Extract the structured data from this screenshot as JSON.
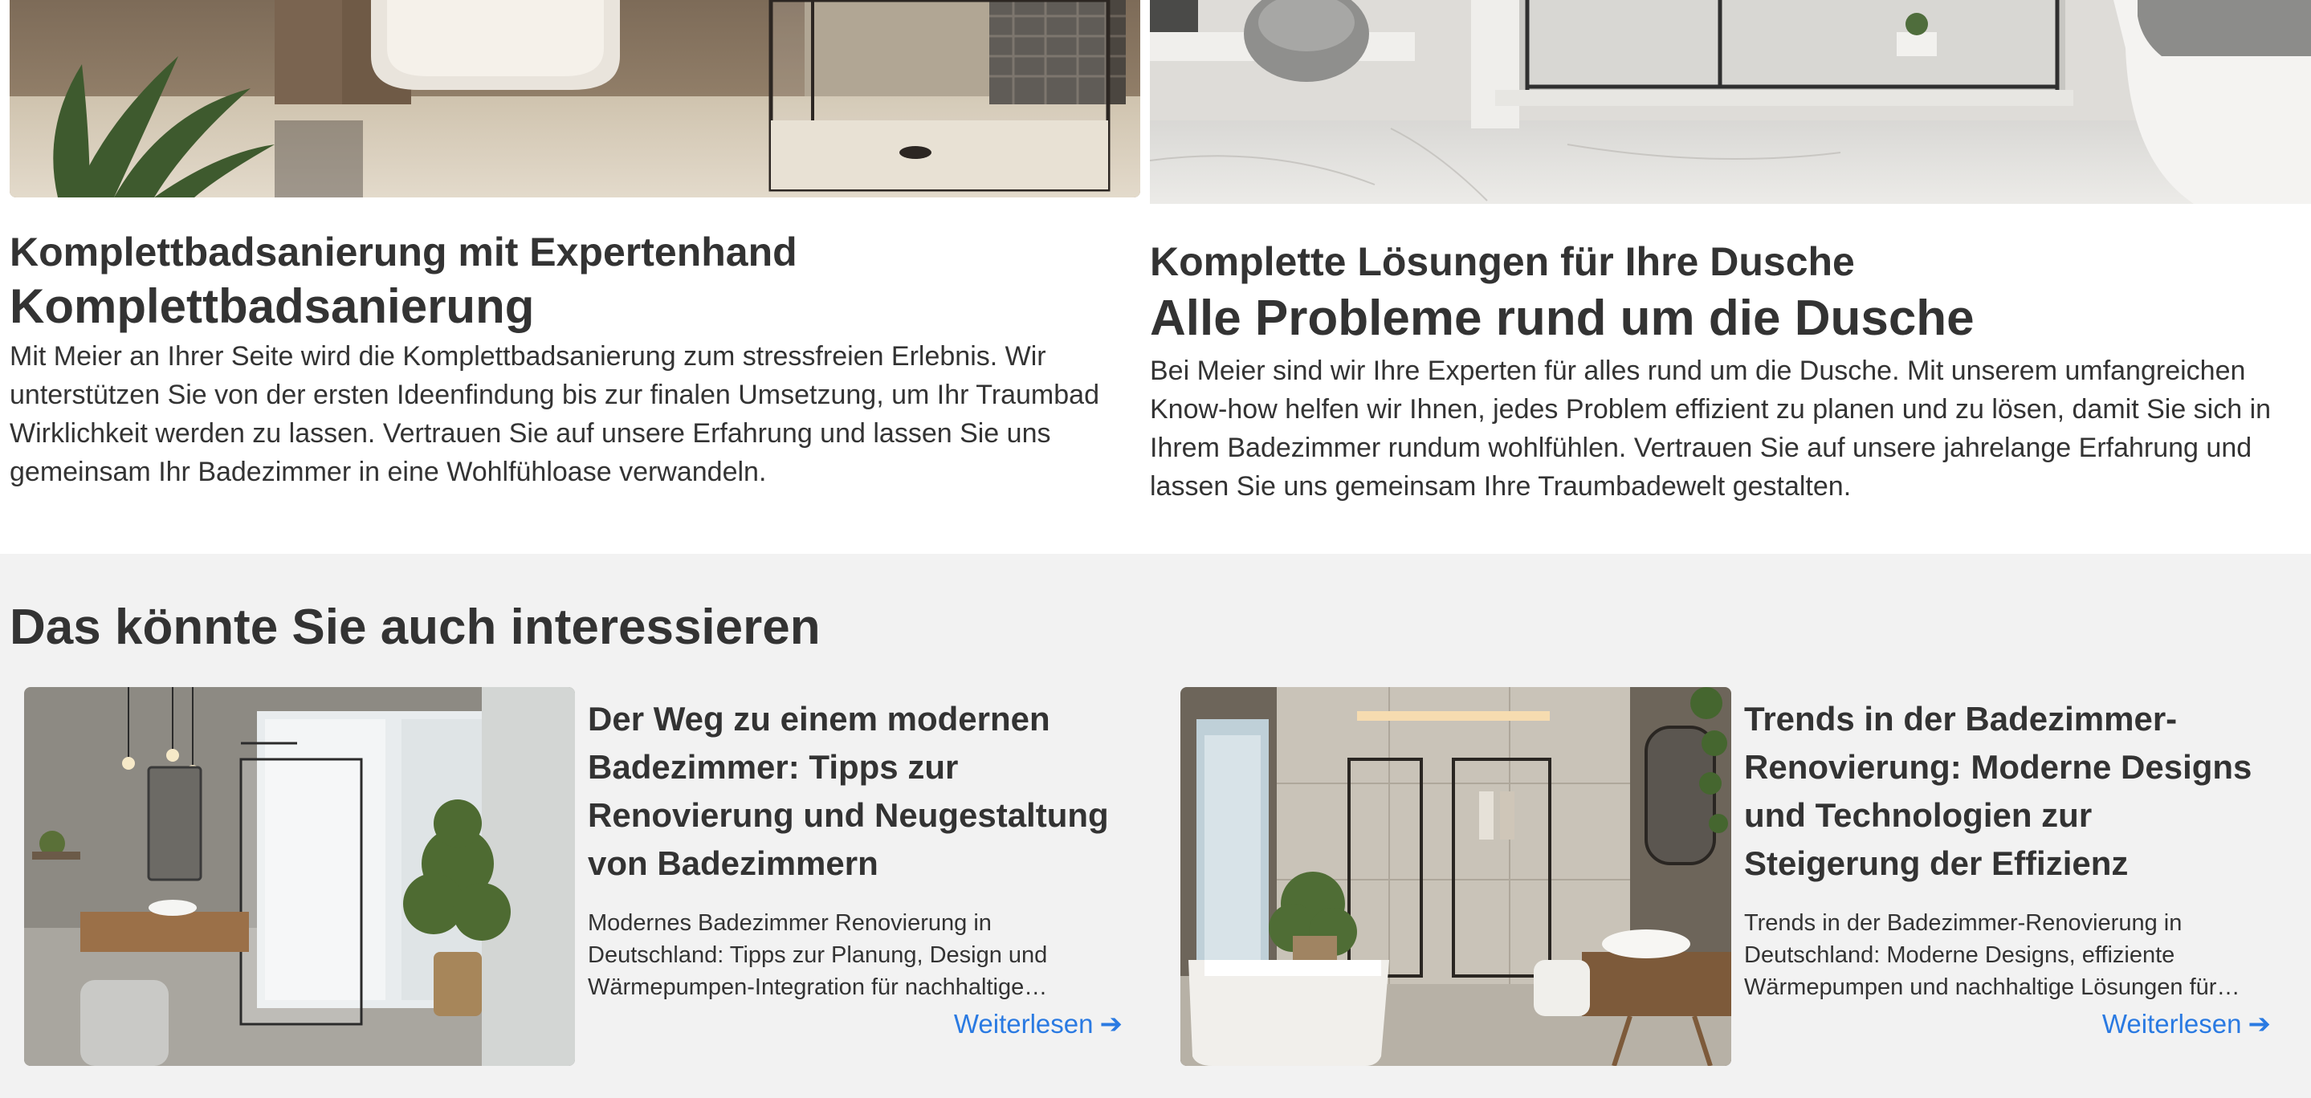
{
  "services": [
    {
      "kicker": "Komplettbadsanierung mit Expertenhand",
      "title": "Komplettbadsanierung",
      "text": "Mit Meier an Ihrer Seite wird die Komplettbadsanierung zum stressfreien Erlebnis. Wir unterstützen Sie von der ersten Ideenfindung bis zur finalen Umsetzung, um Ihr Traumbad Wirklichkeit werden zu lassen. Vertrauen Sie auf unsere Erfahrung und lassen Sie uns gemeinsam Ihr Badezimmer in eine Wohlfühloase verwandeln."
    },
    {
      "kicker": "Komplette Lösungen für Ihre Dusche",
      "title": "Alle Probleme rund um die Dusche",
      "text": "Bei Meier sind wir Ihre Experten für alles rund um die Dusche. Mit unserem umfangreichen Know-how helfen wir Ihnen, jedes Problem effizient zu planen und zu lösen, damit Sie sich in Ihrem Badezimmer rundum wohlfühlen. Vertrauen Sie auf unsere jahrelange Erfahrung und lassen Sie uns gemeinsam Ihre Traumbadewelt gestalten."
    }
  ],
  "related": {
    "heading": "Das könnte Sie auch interessieren",
    "cards": [
      {
        "title": "Der Weg zu einem modernen Badezimmer: Tipps zur Renovierung und Neugestaltung von Badezimmern",
        "excerpt": "Modernes Badezimmer Renovierung in Deutschland: Tipps zur Planung, Design und Wärmepumpen-Integration für nachhaltige Badezimmer.",
        "link": "Weiterlesen",
        "link_icon": "arrow-right-icon"
      },
      {
        "title": "Trends in der Badezimmer-Renovierung: Moderne Designs und Technologien zur Steigerung der Effizienz",
        "excerpt": "Trends in der Badezimmer-Renovierung in Deutschland: Moderne Designs, effiziente Wärmepumpen und nachhaltige Lösungen für mehr Komfort.",
        "link": "Weiterlesen",
        "link_icon": "arrow-right-icon"
      }
    ]
  },
  "colors": {
    "text": "#333333",
    "link": "#2a7ae2",
    "section_bg": "#f2f2f2"
  }
}
